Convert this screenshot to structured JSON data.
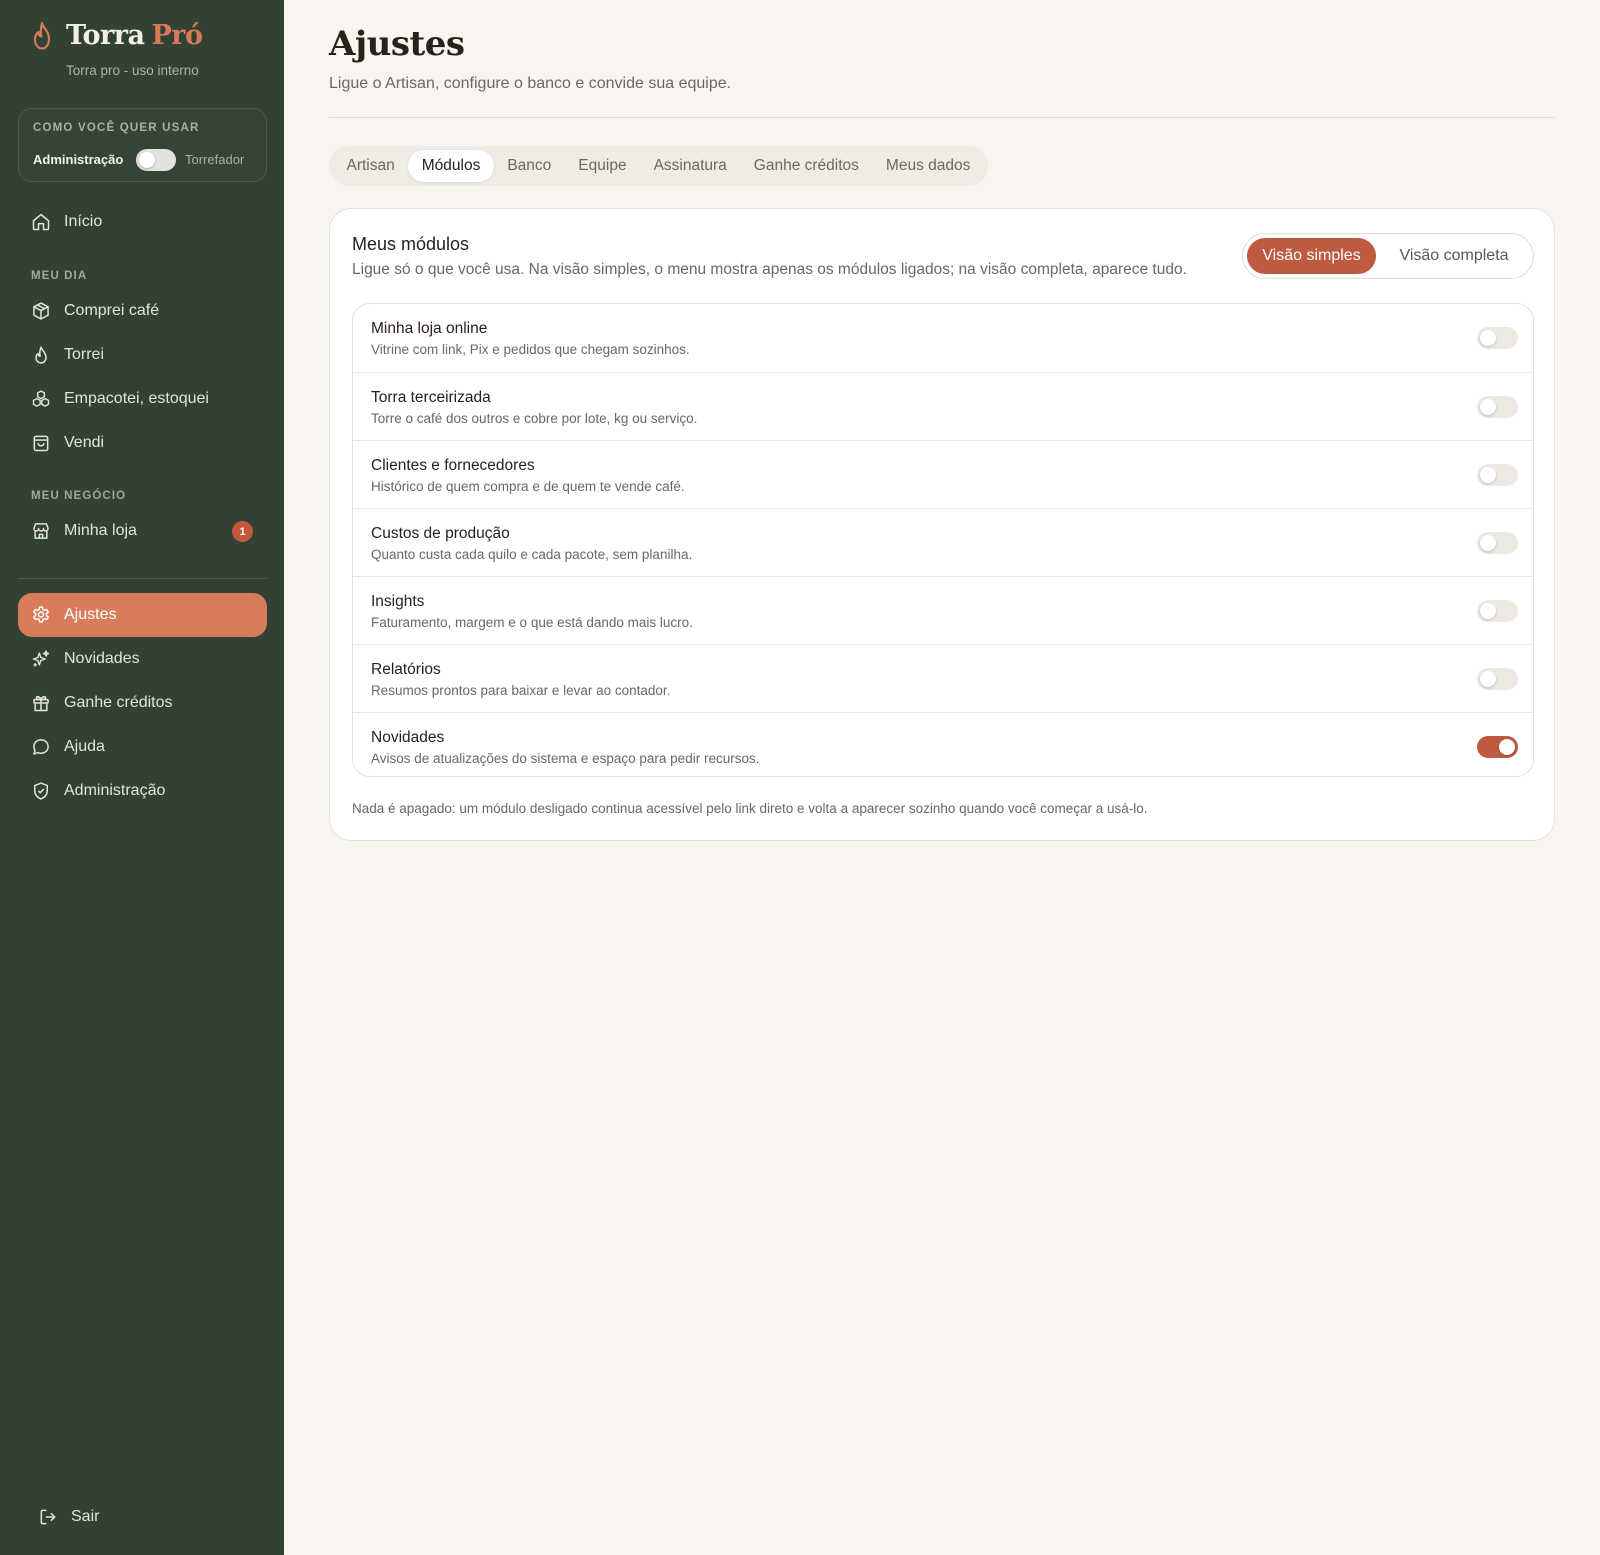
{
  "brand": {
    "name": "Torra",
    "accent": "Pró",
    "subtitle": "Torra pro - uso interno",
    "accent_color": "#d9795a"
  },
  "mode": {
    "title": "COMO VOCÊ QUER USAR",
    "left_label": "Administração",
    "right_label": "Torrefador"
  },
  "nav": {
    "home": {
      "label": "Início",
      "icon": "home-icon"
    },
    "section_day": "MEU DIA",
    "day_items": [
      {
        "label": "Comprei café",
        "icon": "package-icon"
      },
      {
        "label": "Torrei",
        "icon": "flame-icon"
      },
      {
        "label": "Empacotei, estoquei",
        "icon": "boxes-icon"
      },
      {
        "label": "Vendi",
        "icon": "shopping-bag-icon"
      }
    ],
    "section_business": "MEU NEGÓCIO",
    "business_items": [
      {
        "label": "Minha loja",
        "icon": "store-icon",
        "badge": "1"
      }
    ],
    "bottom_items": [
      {
        "label": "Ajustes",
        "icon": "gear-icon",
        "active": true
      },
      {
        "label": "Novidades",
        "icon": "sparkles-icon"
      },
      {
        "label": "Ganhe créditos",
        "icon": "gift-icon"
      },
      {
        "label": "Ajuda",
        "icon": "chat-bubble-icon"
      },
      {
        "label": "Administração",
        "icon": "shield-icon"
      }
    ],
    "logout": {
      "label": "Sair",
      "icon": "logout-icon"
    }
  },
  "header": {
    "title": "Ajustes",
    "subtitle": "Ligue o Artisan, configure o banco e convide sua equipe."
  },
  "tabs": [
    {
      "label": "Artisan"
    },
    {
      "label": "Módulos",
      "active": true
    },
    {
      "label": "Banco"
    },
    {
      "label": "Equipe"
    },
    {
      "label": "Assinatura"
    },
    {
      "label": "Ganhe créditos"
    },
    {
      "label": "Meus dados"
    }
  ],
  "modules_card": {
    "title": "Meus módulos",
    "description": "Ligue só o que você usa. Na visão simples, o menu mostra apenas os módulos ligados; na visão completa, aparece tudo.",
    "view_simple": "Visão simples",
    "view_full": "Visão completa",
    "selected_view": "Visão simples",
    "items": [
      {
        "name": "Minha loja online",
        "desc": "Vitrine com link, Pix e pedidos que chegam sozinhos.",
        "enabled": false
      },
      {
        "name": "Torra terceirizada",
        "desc": "Torre o café dos outros e cobre por lote, kg ou serviço.",
        "enabled": false
      },
      {
        "name": "Clientes e fornecedores",
        "desc": "Histórico de quem compra e de quem te vende café.",
        "enabled": false
      },
      {
        "name": "Custos de produção",
        "desc": "Quanto custa cada quilo e cada pacote, sem planilha.",
        "enabled": false
      },
      {
        "name": "Insights",
        "desc": "Faturamento, margem e o que está dando mais lucro.",
        "enabled": false
      },
      {
        "name": "Relatórios",
        "desc": "Resumos prontos para baixar e levar ao contador.",
        "enabled": false
      },
      {
        "name": "Novidades",
        "desc": "Avisos de atualizações do sistema e espaço para pedir recursos.",
        "enabled": true
      }
    ],
    "note": "Nada é apagado: um módulo desligado continua acessível pelo link direto e volta a aparecer sozinho quando você começar a usá-lo."
  },
  "colors": {
    "sidebar_bg": "#314232",
    "accent": "#d97c5c",
    "toggle_on": "#bd5a3f",
    "page_bg": "#f8f5f0"
  }
}
